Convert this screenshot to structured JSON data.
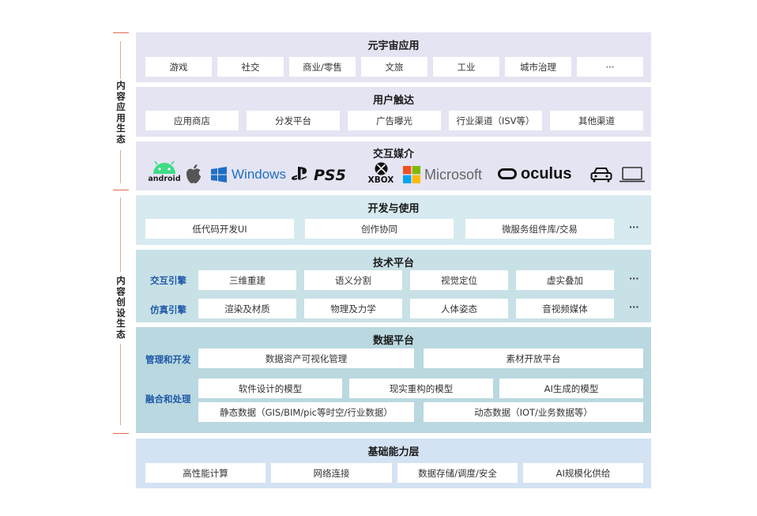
{
  "side_labels": {
    "content_application": "内容应用生态",
    "content_creation": "内容创设生态"
  },
  "layers": {
    "metaverse_apps": {
      "title": "元宇宙应用",
      "items": [
        "游戏",
        "社交",
        "商业/零售",
        "文旅",
        "工业",
        "城市治理",
        "···"
      ]
    },
    "user_reach": {
      "title": "用户触达",
      "items": [
        "应用商店",
        "分发平台",
        "广告曝光",
        "行业渠道（ISV等）",
        "其他渠道"
      ]
    },
    "interaction_media": {
      "title": "交互媒介",
      "logos": {
        "android": "android",
        "windows": "Windows",
        "xbox": "XBOX",
        "microsoft": "Microsoft",
        "oculus": "oculus"
      }
    },
    "dev_use": {
      "title": "开发与使用",
      "items": [
        "低代码开发UI",
        "创作协同",
        "微服务组件库/交易"
      ],
      "more": "···"
    },
    "tech_platform": {
      "title": "技术平台",
      "rows": [
        {
          "label": "交互引擎",
          "items": [
            "三维重建",
            "语义分割",
            "视觉定位",
            "虚实叠加"
          ],
          "more": "···"
        },
        {
          "label": "仿真引擎",
          "items": [
            "渲染及材质",
            "物理及力学",
            "人体姿态",
            "音视频媒体"
          ],
          "more": "···"
        }
      ]
    },
    "data_platform": {
      "title": "数据平台",
      "management_label": "管理和开发",
      "management_items": [
        "数据资产可视化管理",
        "素材开放平台"
      ],
      "fusion_label": "融合和处理",
      "model_items": [
        "软件设计的模型",
        "现实重构的模型",
        "AI生成的模型"
      ],
      "data_items": [
        "静态数据（GIS/BIM/pic等时空/行业数据）",
        "动态数据（IOT/业务数据等）"
      ]
    },
    "infrastructure": {
      "title": "基础能力层",
      "items": [
        "高性能计算",
        "网络连接",
        "数据存储/调度/安全",
        "AI规模化供给"
      ]
    }
  }
}
